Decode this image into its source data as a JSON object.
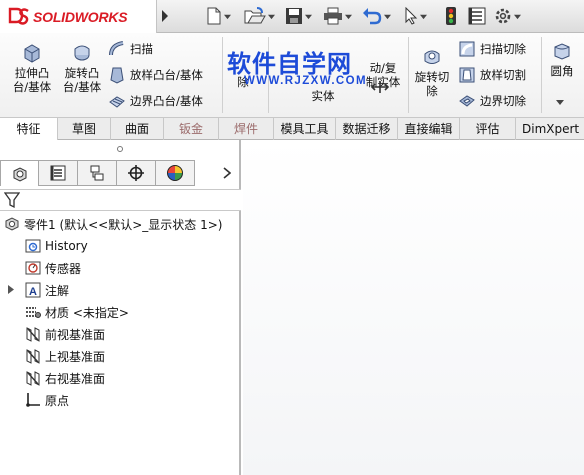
{
  "app": {
    "brand": "SOLIDWORKS",
    "logo_icon": "ds-logo-icon"
  },
  "quick_access": [
    "new-icon",
    "open-icon",
    "save-icon",
    "print-icon",
    "undo-icon",
    "select-icon",
    "rebuild-icon",
    "file-properties-icon",
    "options-icon"
  ],
  "ribbon": {
    "extrude_boss": [
      "拉伸凸",
      "台/基体"
    ],
    "revolve_boss": [
      "旋转凸",
      "台/基体"
    ],
    "sweep": "扫描",
    "loft": "放样凸台/基体",
    "boundary": "边界凸台/基体",
    "partial_left": "除",
    "partial_mid": "实体",
    "move_copy": [
      "动/复",
      "制实体"
    ],
    "revolve_cut": [
      "旋转切",
      "除"
    ],
    "sweep_cut": "扫描切除",
    "loft_cut": "放样切割",
    "boundary_cut": "边界切除",
    "fillet": "圆角"
  },
  "watermark": {
    "cn": "软件自学网",
    "en": "WWW.RJZXW.COM"
  },
  "tabs": [
    {
      "label": "特征",
      "active": true
    },
    {
      "label": "草图"
    },
    {
      "label": "曲面"
    },
    {
      "label": "钣金",
      "dim": true
    },
    {
      "label": "焊件",
      "dim": true
    },
    {
      "label": "模具工具"
    },
    {
      "label": "数据迁移"
    },
    {
      "label": "直接编辑"
    },
    {
      "label": "评估"
    },
    {
      "label": "DimXpert"
    }
  ],
  "feature_tree": {
    "root": "零件1  (默认<<默认>_显示状态 1>)",
    "items": [
      {
        "label": "History",
        "icon": "history-icon"
      },
      {
        "label": "传感器",
        "icon": "sensor-icon"
      },
      {
        "label": "注解",
        "icon": "annotation-icon",
        "expandable": true
      },
      {
        "label": "材质 <未指定>",
        "icon": "material-icon"
      },
      {
        "label": "前视基准面",
        "icon": "plane-icon"
      },
      {
        "label": "上视基准面",
        "icon": "plane-icon"
      },
      {
        "label": "右视基准面",
        "icon": "plane-icon"
      },
      {
        "label": "原点",
        "icon": "origin-icon"
      }
    ]
  }
}
